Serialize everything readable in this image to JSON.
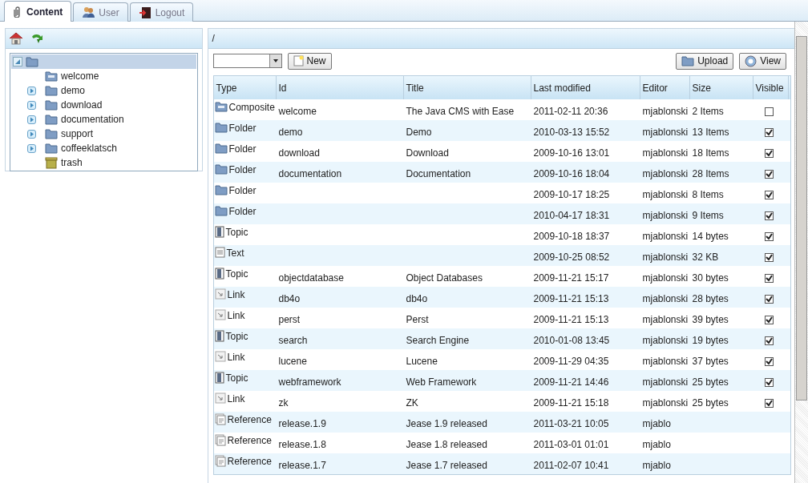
{
  "tabs": [
    {
      "label": "Content",
      "selected": true
    },
    {
      "label": "User",
      "selected": false
    },
    {
      "label": "Logout",
      "selected": false
    }
  ],
  "tree": {
    "selected": true,
    "expanded": true,
    "children": [
      {
        "label": "welcome",
        "kind": "composite"
      },
      {
        "label": "demo",
        "kind": "folder",
        "expanded": false
      },
      {
        "label": "download",
        "kind": "folder",
        "expanded": false
      },
      {
        "label": "documentation",
        "kind": "folder",
        "expanded": false
      },
      {
        "label": "support",
        "kind": "folder",
        "expanded": false
      },
      {
        "label": "coffeeklatsch",
        "kind": "folder",
        "expanded": false
      },
      {
        "label": "trash",
        "kind": "trash"
      }
    ]
  },
  "path": "/",
  "toolbar": {
    "new_button": "New",
    "upload_button": "Upload",
    "view_button": "View"
  },
  "table": {
    "columns": [
      "Type",
      "Id",
      "Title",
      "Last modified",
      "Editor",
      "Size",
      "Visible"
    ],
    "rows": [
      {
        "kind": "composite",
        "type": "Composite",
        "id": "welcome",
        "title": "The Java CMS with Ease",
        "modified": "2011-02-11 20:36",
        "editor": "mjablonski",
        "size": "2 Items",
        "visible": false
      },
      {
        "kind": "folder",
        "type": "Folder",
        "id": "demo",
        "title": "Demo",
        "modified": "2010-03-13 15:52",
        "editor": "mjablonski",
        "size": "13 Items",
        "visible": true
      },
      {
        "kind": "folder",
        "type": "Folder",
        "id": "download",
        "title": "Download",
        "modified": "2009-10-16 13:01",
        "editor": "mjablonski",
        "size": "18 Items",
        "visible": true
      },
      {
        "kind": "folder",
        "type": "Folder",
        "id": "documentation",
        "title": "Documentation",
        "modified": "2009-10-16 18:04",
        "editor": "mjablonski",
        "size": "28 Items",
        "visible": true
      },
      {
        "kind": "folder",
        "type": "Folder",
        "modified": "2009-10-17 18:25",
        "editor": "mjablonski",
        "size": "8 Items",
        "visible": true
      },
      {
        "kind": "folder",
        "type": "Folder",
        "modified": "2010-04-17 18:31",
        "editor": "mjablonski",
        "size": "9 Items",
        "visible": true
      },
      {
        "kind": "topic",
        "type": "Topic",
        "modified": "2009-10-18 18:37",
        "editor": "mjablonski",
        "size": "14 bytes",
        "visible": true
      },
      {
        "kind": "text",
        "type": "Text",
        "modified": "2009-10-25 08:52",
        "editor": "mjablonski",
        "size": "32 KB",
        "visible": true
      },
      {
        "kind": "topic",
        "type": "Topic",
        "id": "objectdatabase",
        "title": "Object Databases",
        "modified": "2009-11-21 15:17",
        "editor": "mjablonski",
        "size": "30 bytes",
        "visible": true
      },
      {
        "kind": "link",
        "type": "Link",
        "id": "db4o",
        "title": "db4o",
        "modified": "2009-11-21 15:13",
        "editor": "mjablonski",
        "size": "28 bytes",
        "visible": true
      },
      {
        "kind": "link",
        "type": "Link",
        "id": "perst",
        "title": "Perst",
        "modified": "2009-11-21 15:13",
        "editor": "mjablonski",
        "size": "39 bytes",
        "visible": true
      },
      {
        "kind": "topic",
        "type": "Topic",
        "id": "search",
        "title": "Search Engine",
        "modified": "2010-01-08 13:45",
        "editor": "mjablonski",
        "size": "19 bytes",
        "visible": true
      },
      {
        "kind": "link",
        "type": "Link",
        "id": "lucene",
        "title": "Lucene",
        "modified": "2009-11-29 04:35",
        "editor": "mjablonski",
        "size": "37 bytes",
        "visible": true
      },
      {
        "kind": "topic",
        "type": "Topic",
        "id": "webframework",
        "title": "Web Framework",
        "modified": "2009-11-21 14:46",
        "editor": "mjablonski",
        "size": "25 bytes",
        "visible": true
      },
      {
        "kind": "link",
        "type": "Link",
        "id": "zk",
        "title": "ZK",
        "modified": "2009-11-21 15:18",
        "editor": "mjablonski",
        "size": "25 bytes",
        "visible": true
      },
      {
        "kind": "reference",
        "type": "Reference",
        "id": "release.1.9",
        "title": "Jease 1.9 released",
        "modified": "2011-03-21 10:05",
        "editor": "mjablo"
      },
      {
        "kind": "reference",
        "type": "Reference",
        "id": "release.1.8",
        "title": "Jease 1.8 released",
        "modified": "2011-03-01 01:01",
        "editor": "mjablo"
      },
      {
        "kind": "reference",
        "type": "Reference",
        "id": "release.1.7",
        "title": "Jease 1.7 released",
        "modified": "2011-02-07 10:41",
        "editor": "mjablo"
      }
    ]
  }
}
